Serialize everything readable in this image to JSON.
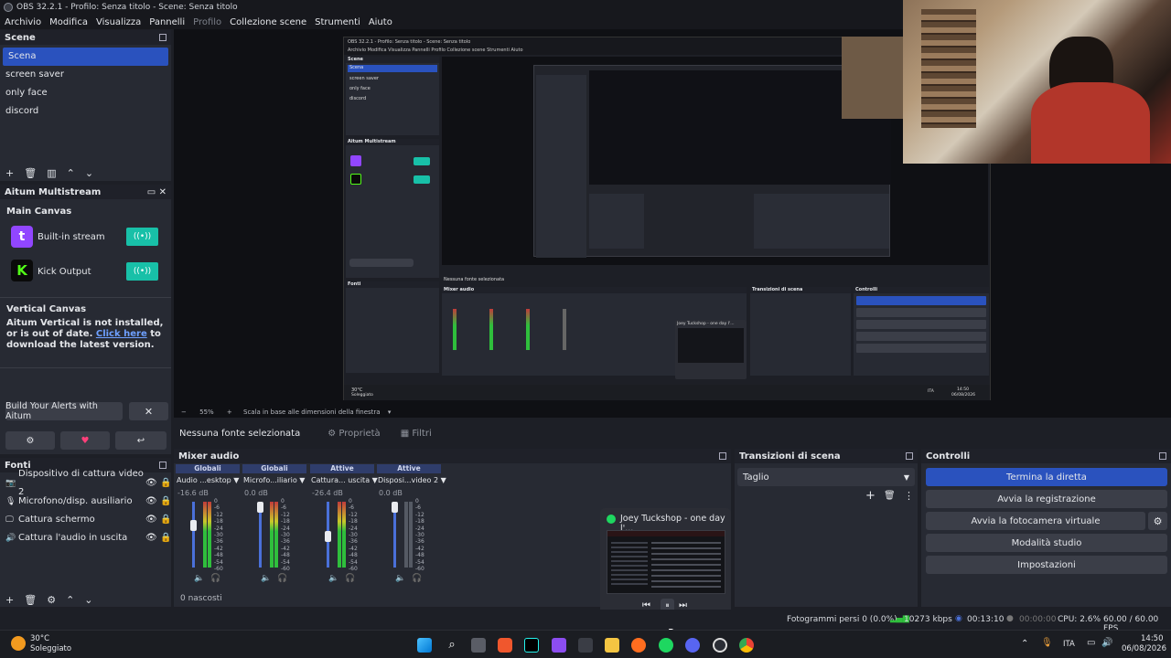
{
  "window": {
    "title": "OBS 32.2.1 - Profilo: Senza titolo - Scene: Senza titolo"
  },
  "menu": [
    "Archivio",
    "Modifica",
    "Visualizza",
    "Pannelli",
    "Profilo",
    "Collezione scene",
    "Strumenti",
    "Aiuto"
  ],
  "scenes": {
    "title": "Scene",
    "items": [
      "Scena",
      "screen saver",
      "only face",
      "discord"
    ]
  },
  "multistream": {
    "title": "Aitum Multistream",
    "main_canvas": "Main Canvas",
    "outputs": [
      {
        "label": "Built-in stream",
        "color": "#9146ff"
      },
      {
        "label": "Kick Output",
        "color": "#53fc18"
      }
    ],
    "vertical_canvas": "Vertical Canvas",
    "vertical_msg": "Aitum Vertical is not installed, or is out of date.",
    "click_here": "Click here",
    "download_msg": " to download the latest version.",
    "alerts_button": "Build Your Alerts with Aitum"
  },
  "sources": {
    "title": "Fonti",
    "items": [
      "Dispositivo di cattura video 2",
      "Microfono/disp. ausiliario",
      "Cattura schermo",
      "Cattura l'audio in uscita"
    ]
  },
  "context_bar": {
    "no_source": "Nessuna fonte selezionata",
    "properties": "Proprietà",
    "filters": "Filtri"
  },
  "mixer": {
    "title": "Mixer audio",
    "channels": [
      {
        "group": "Globali",
        "name": "Audio ...esktop",
        "db": "-16.6 dB"
      },
      {
        "group": "Globali",
        "name": "Microfo...iliario",
        "db": "0.0 dB"
      },
      {
        "group": "Attive",
        "name": "Cattura... uscita",
        "db": "-26.4 dB"
      },
      {
        "group": "Attive",
        "name": "Disposi...video 2",
        "db": "0.0 dB"
      }
    ],
    "scale": [
      "0",
      "-6",
      "-12",
      "-18",
      "-24",
      "-30",
      "-36",
      "-42",
      "-48",
      "-54",
      "-60"
    ],
    "hidden": "0 nascosti"
  },
  "transitions": {
    "title": "Transizioni di scena",
    "selected": "Taglio"
  },
  "controls": {
    "title": "Controlli",
    "buttons": [
      "Termina la diretta",
      "Avvia la registrazione",
      "Avvia la fotocamera virtuale",
      "Modalità studio",
      "Impostazioni"
    ]
  },
  "media_popup": {
    "title": "Joey Tuckshop - one day l'..."
  },
  "statusbar": {
    "dropped": "Fotogrammi persi 0 (0.0%)",
    "kbps": "10273 kbps",
    "live_time": "00:13:10",
    "rec_time": "00:00:00",
    "cpu": "CPU: 2.6%",
    "fps": "60.00 / 60.00 FPS"
  },
  "taskbar": {
    "temp": "30°C",
    "weather": "Soleggiato",
    "lang": "ITA",
    "time": "14:50",
    "date": "06/08/2026"
  },
  "preview_inner": {
    "title": "OBS 32.2.1 - Profilo: Senza titolo - Scene: Senza titolo",
    "zoom": "55%",
    "scale_label": "Scala in base alle dimensioni della finestra",
    "stream_name": "Joey Tuckshop - one day l'...",
    "temp": "30°C",
    "weather": "Soleggiato",
    "time": "14:50",
    "date": "06/08/2026",
    "lang": "ITA"
  }
}
